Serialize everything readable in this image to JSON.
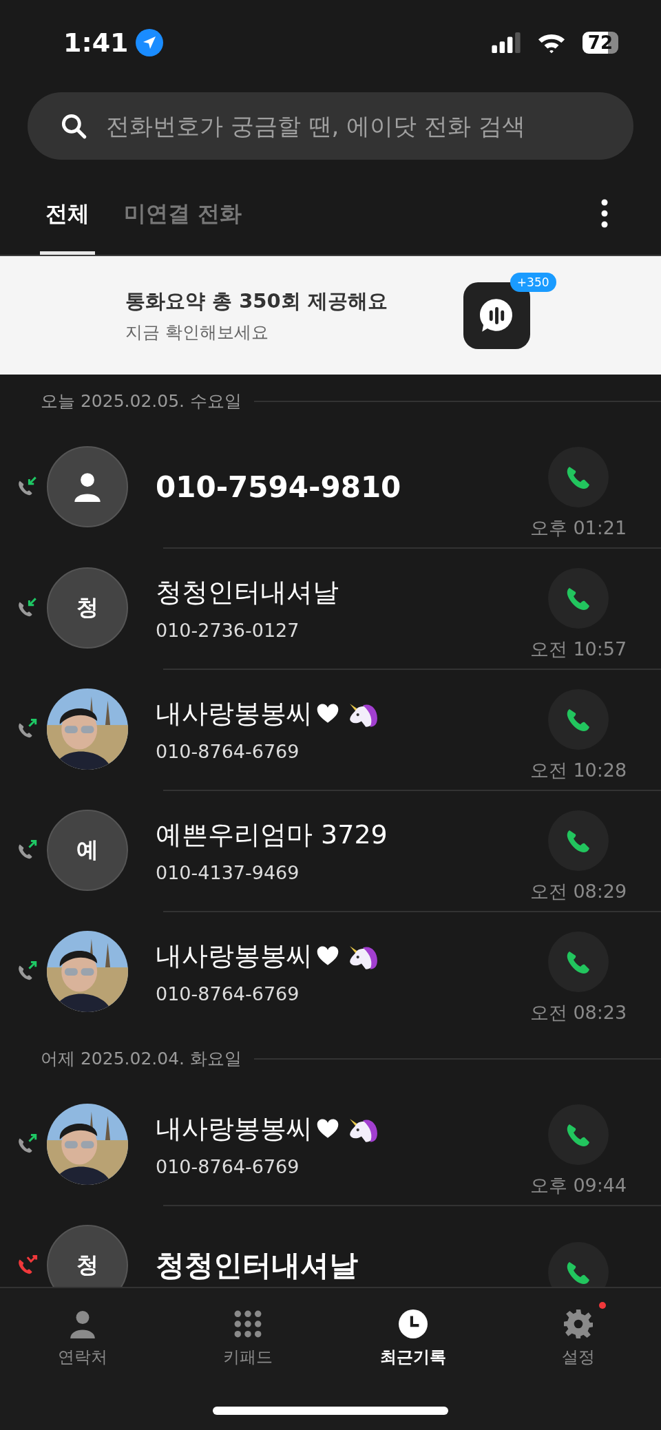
{
  "status_bar": {
    "time": "1:41",
    "battery": "72"
  },
  "search": {
    "placeholder": "전화번호가 궁금할 땐, 에이닷 전화 검색"
  },
  "tabs": [
    {
      "label": "전체",
      "selected": true
    },
    {
      "label": "미연결 전화",
      "selected": false
    }
  ],
  "banner": {
    "title": "통화요약 총 350회 제공해요",
    "subtitle": "지금 확인해보세요",
    "badge": "+350"
  },
  "sections": [
    {
      "header": "오늘 2025.02.05. 수요일",
      "calls": [
        {
          "kind": "incoming",
          "avatar": {
            "kind": "person"
          },
          "name": "010-7594-9810",
          "time": "오후 01:21"
        },
        {
          "kind": "incoming",
          "avatar": {
            "kind": "initial",
            "text": "청"
          },
          "name": "청청인터내셔날",
          "number": "010-2736-0127",
          "time": "오전 10:57"
        },
        {
          "kind": "outgoing",
          "name": "내사랑봉봉씨",
          "emoji": [
            {
              "kind": "heart"
            },
            {
              "kind": "unicorn"
            }
          ],
          "number": "010-8764-6769",
          "time": "오전 10:28"
        },
        {
          "kind": "outgoing",
          "avatar": {
            "kind": "initial",
            "text": "예"
          },
          "name": "예쁜우리엄마 3729",
          "number": "010-4137-9469",
          "time": "오전 08:29"
        },
        {
          "kind": "outgoing",
          "name": "내사랑봉봉씨",
          "emoji": [
            {
              "kind": "heart"
            },
            {
              "kind": "unicorn"
            }
          ],
          "number": "010-8764-6769",
          "time": "오전 08:23"
        }
      ]
    },
    {
      "header": "어제 2025.02.04. 화요일",
      "calls": [
        {
          "kind": "outgoing",
          "name": "내사랑봉봉씨",
          "emoji": [
            {
              "kind": "heart"
            },
            {
              "kind": "unicorn"
            }
          ],
          "number": "010-8764-6769",
          "time": "오후 09:44"
        },
        {
          "kind": "missed",
          "avatar": {
            "kind": "initial",
            "text": "청"
          },
          "name": "청청인터내셔날"
        }
      ]
    }
  ],
  "nav": [
    {
      "kind": "contacts",
      "label": "연락처",
      "selected": false,
      "dot": false
    },
    {
      "kind": "keypad",
      "label": "키패드",
      "selected": false,
      "dot": false
    },
    {
      "kind": "recents",
      "label": "최근기록",
      "selected": true,
      "dot": false
    },
    {
      "kind": "settings",
      "label": "설정",
      "selected": false,
      "dot": true
    }
  ]
}
